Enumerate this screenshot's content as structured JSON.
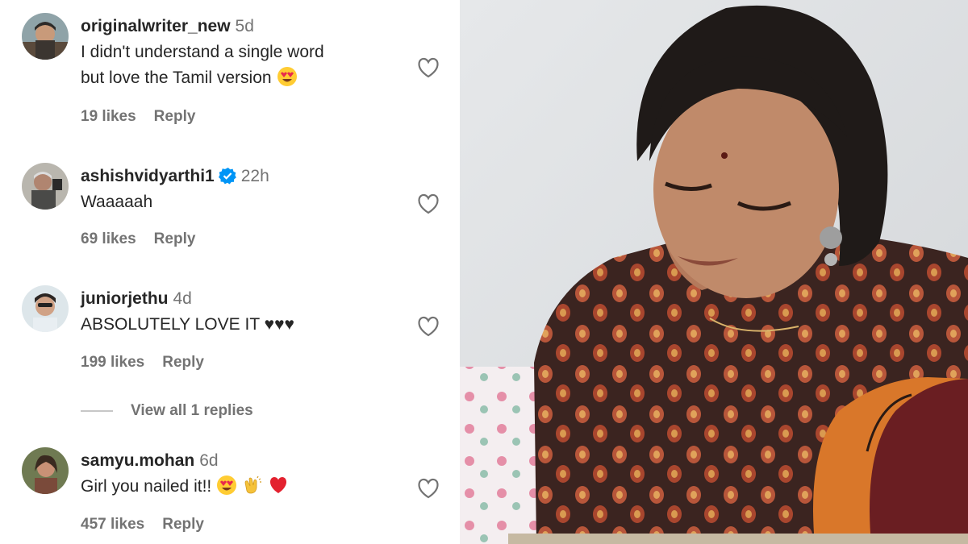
{
  "comments": [
    {
      "username": "originalwriter_new",
      "time": "5d",
      "line1": "I didn't understand a single word",
      "line2": "but love the Tamil version",
      "emojis": [
        "heart-eyes"
      ],
      "likes": "19 likes",
      "reply": "Reply",
      "verified": false
    },
    {
      "username": "ashishvidyarthi1",
      "time": "22h",
      "line1": "Waaaaah",
      "line2": "",
      "emojis": [],
      "likes": "69 likes",
      "reply": "Reply",
      "verified": true
    },
    {
      "username": "juniorjethu",
      "time": "4d",
      "line1": "ABSOLUTELY LOVE IT ♥♥♥",
      "line2": "",
      "emojis": [],
      "likes": "199 likes",
      "reply": "Reply",
      "verified": false
    },
    {
      "username": "samyu.mohan",
      "time": "6d",
      "line1": "Girl you nailed it!!",
      "line2": "",
      "emojis": [
        "heart-eyes",
        "clapping-hands",
        "red-heart"
      ],
      "likes": "457 likes",
      "reply": "Reply",
      "verified": false
    }
  ],
  "view_replies": "View all 1 replies",
  "colors": {
    "text": "#262626",
    "secondary": "#737373",
    "verified_blue": "#0095f6",
    "heart_red": "#ed2a3a"
  }
}
